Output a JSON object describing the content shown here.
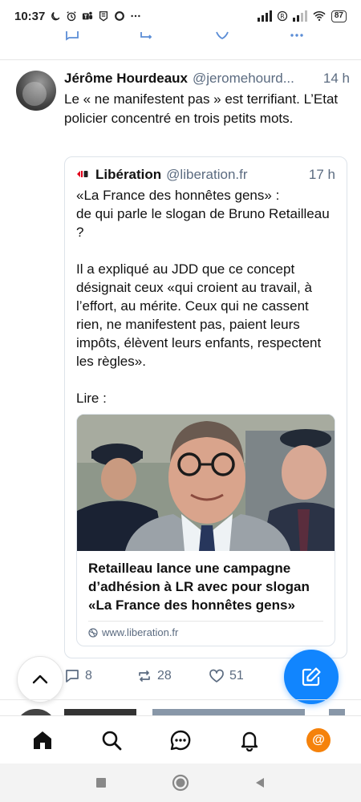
{
  "status_bar": {
    "time": "10:37",
    "battery": "87",
    "left_icons": [
      "moon-icon",
      "alarm-icon",
      "teams-icon",
      "app-icon",
      "circle-app-icon",
      "more-dots-icon"
    ],
    "right_icons": [
      "signal-icon",
      "r-icon",
      "signal-icon",
      "wifi-icon",
      "battery-icon"
    ]
  },
  "post": {
    "author_name": "Jérôme Hourdeaux",
    "author_handle": "@jeromehourd...",
    "time": "14 h",
    "text": "Le « ne manifestent pas » est terrifiant. L’Etat policier concentré en trois petits mots.",
    "quote": {
      "author_name": "Libération",
      "author_handle": "@liberation.fr",
      "time": "17 h",
      "text": "«La France des honnêtes gens» :\nde qui parle le slogan de Bruno Retailleau ?\n\nIl a expliqué au JDD que ce concept désignait ceux «qui croient au travail, à l’effort, au mérite. Ceux qui ne cassent rien, ne manifestent pas, paient leurs impôts, élèvent leurs enfants, respectent les règles».\n\nLire :",
      "card": {
        "title": "Retailleau lance une campagne d’adhésion à LR avec pour slogan «La France des honnêtes gens»",
        "url": "www.liberation.fr"
      }
    },
    "actions": {
      "replies": "8",
      "reposts": "28",
      "likes": "51"
    }
  },
  "bottom_nav": {
    "items": [
      "home-icon",
      "search-icon",
      "chat-icon",
      "bell-icon",
      "profile-avatar"
    ],
    "avatar_symbol": "@"
  },
  "colors": {
    "accent": "#1185fe",
    "muted": "#5b6b80",
    "avatar_orange": "#f5820b"
  }
}
